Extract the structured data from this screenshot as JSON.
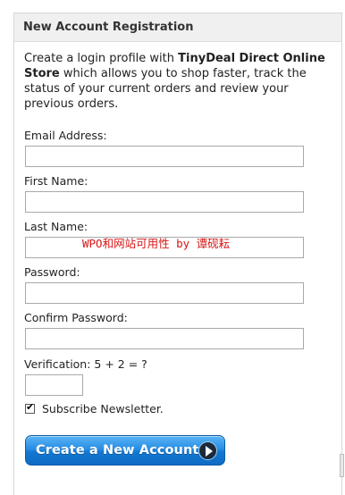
{
  "panel": {
    "title": "New Account Registration"
  },
  "intro": {
    "text_before": "Create a login profile with ",
    "store_name": "TinyDeal Direct Online Store",
    "text_after": " which allows you to shop faster, track the status of your current orders and review your previous orders."
  },
  "form": {
    "email_label": "Email Address:",
    "email_value": "",
    "first_name_label": "First Name:",
    "first_name_value": "",
    "last_name_label": "Last Name:",
    "last_name_value": "",
    "password_label": "Password:",
    "password_value": "",
    "confirm_password_label": "Confirm Password:",
    "confirm_password_value": "",
    "verification_label": "Verification: 5 + 2 = ?",
    "verification_value": "",
    "newsletter_label": "Subscribe Newsletter.",
    "newsletter_checked": true,
    "newsletter_tick": "✔"
  },
  "submit": {
    "label": "Create a New Account",
    "icon": "play-arrow-icon"
  },
  "watermark": {
    "text": "WPO和网站可用性 by 谭砚耘"
  },
  "colors": {
    "button_blue": "#2a8ee6",
    "watermark_red": "#d81414",
    "header_bg": "#f0f0f0"
  }
}
